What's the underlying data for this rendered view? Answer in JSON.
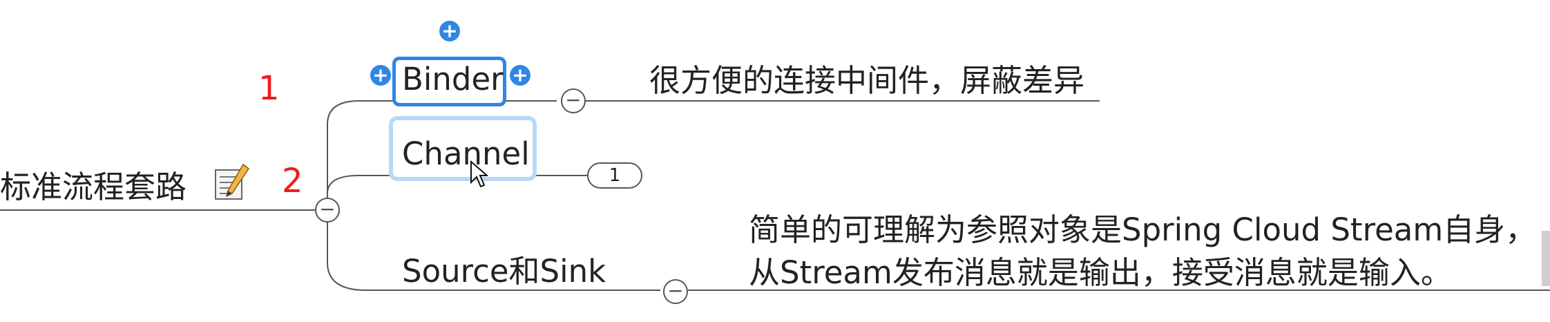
{
  "root": {
    "label": "标准流程套路",
    "icon": "note-pencil-icon"
  },
  "numbers": [
    "1",
    "2"
  ],
  "topics": [
    {
      "label": "Binder",
      "note": "很方便的连接中间件，屏蔽差异",
      "control": "−"
    },
    {
      "label": "Channel",
      "count": "1"
    },
    {
      "label": "Source和Sink",
      "note_lines": [
        "简单的可理解为参照对象是Spring Cloud Stream自身，",
        "从Stream发布消息就是输出，接受消息就是输入。"
      ],
      "control": "−"
    }
  ],
  "root_control": "−",
  "colors": {
    "accent": "#2f86e6",
    "selection_soft": "#b9d7f8",
    "number_red": "#ee1c1c",
    "line": "#555555"
  }
}
